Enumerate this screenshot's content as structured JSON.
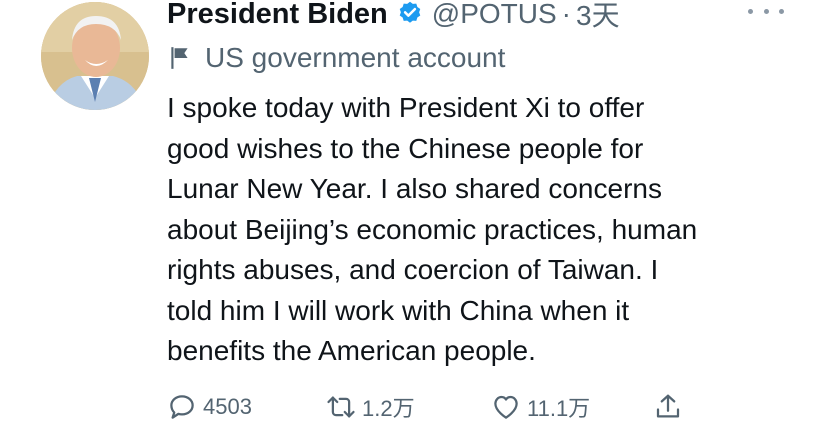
{
  "tweet": {
    "author_name": "President Biden",
    "handle": "@POTUS",
    "separator": "·",
    "time": "3天",
    "account_label": "US government account",
    "text_lines": [
      "I spoke today with President Xi to offer",
      "good wishes to the Chinese people for",
      "Lunar New Year. I also shared concerns",
      "about Beijing’s economic practices, human",
      "rights abuses, and coercion of Taiwan. I",
      "told him I will work with China when it",
      "benefits the American people."
    ]
  },
  "actions": {
    "reply_count": "4503",
    "retweet_count": "1.2万",
    "like_count": "11.1万"
  },
  "icons": {
    "verified": "verified-badge-icon",
    "label": "flag-icon",
    "more": "more-options-icon",
    "reply": "reply-icon",
    "retweet": "retweet-icon",
    "like": "heart-icon",
    "share": "share-icon"
  },
  "colors": {
    "text": "#0f1419",
    "secondary": "#536471",
    "verified": "#1d9bf0"
  }
}
